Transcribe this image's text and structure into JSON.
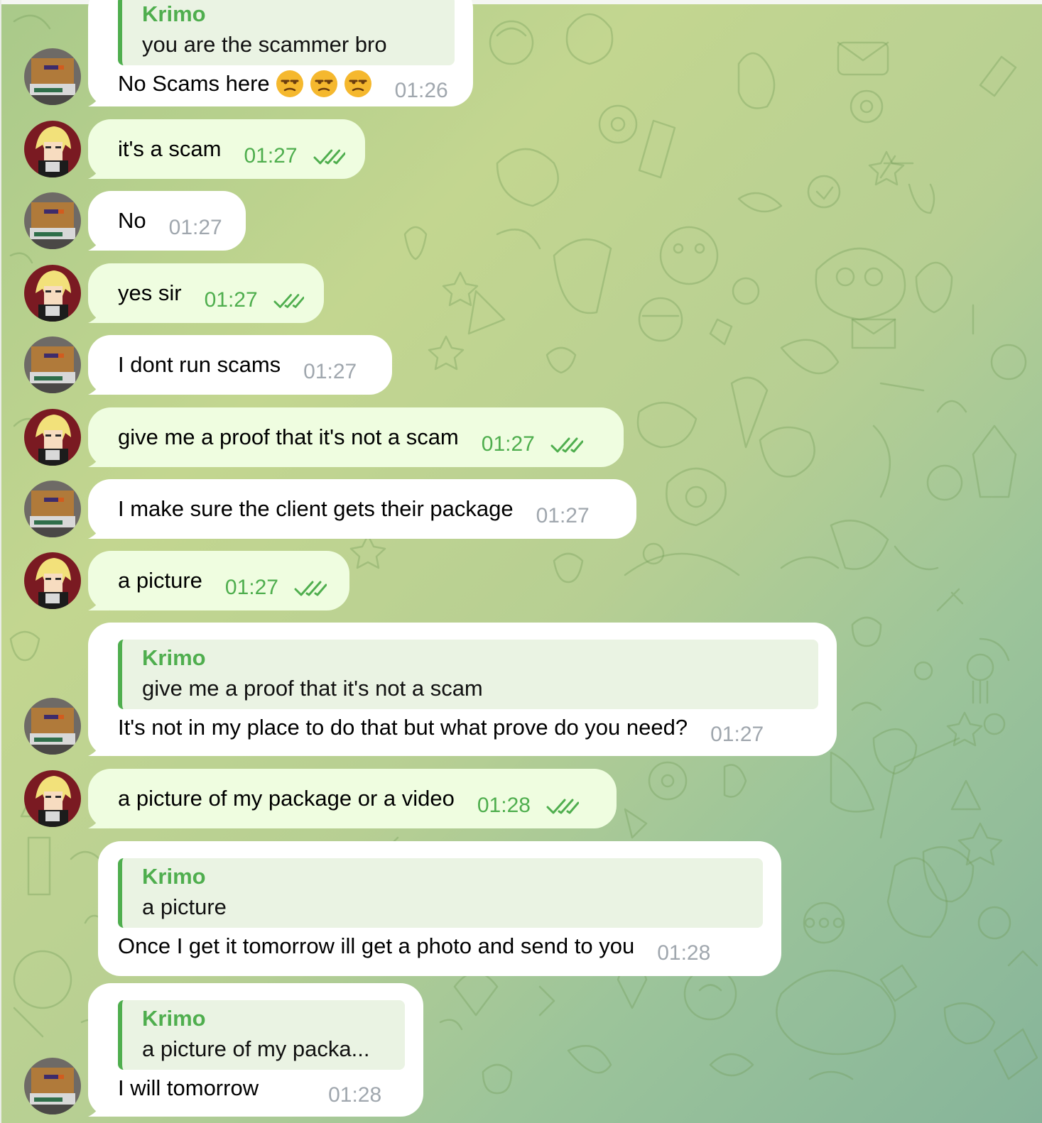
{
  "colors": {
    "accent": "#4fae4e",
    "incoming_bubble": "#ffffff",
    "outgoing_bubble": "#effde0",
    "time_incoming": "#a0a7ae"
  },
  "messages": [
    {
      "side": "in",
      "avatar": "fedex-box-avatar",
      "quote": {
        "name": "Krimo",
        "text": "you are the scammer bro"
      },
      "text": "No Scams here",
      "emoji": [
        "unamused-face",
        "unamused-face",
        "unamused-face"
      ],
      "time": "01:26"
    },
    {
      "side": "out",
      "avatar": "anime-avatar",
      "text": "it's a scam",
      "time": "01:27",
      "read": true
    },
    {
      "side": "in",
      "avatar": "fedex-box-avatar",
      "text": "No",
      "time": "01:27"
    },
    {
      "side": "out",
      "avatar": "anime-avatar",
      "text": "yes sir",
      "time": "01:27",
      "read": true
    },
    {
      "side": "in",
      "avatar": "fedex-box-avatar",
      "text": "I dont run scams",
      "time": "01:27"
    },
    {
      "side": "out",
      "avatar": "anime-avatar",
      "text": "give me a proof that it's not a scam",
      "time": "01:27",
      "read": true
    },
    {
      "side": "in",
      "avatar": "fedex-box-avatar",
      "text": "I make sure the client gets their package",
      "time": "01:27"
    },
    {
      "side": "out",
      "avatar": "anime-avatar",
      "text": "a picture",
      "time": "01:27",
      "read": true
    },
    {
      "side": "in",
      "avatar": "fedex-box-avatar",
      "quote": {
        "name": "Krimo",
        "text": "give me a proof that it's not a scam"
      },
      "text": "It's not in my place to do that but what prove do you need?",
      "time": "01:27"
    },
    {
      "side": "out",
      "avatar": "anime-avatar",
      "text": "a picture of my package or a video",
      "time": "01:28",
      "read": true
    },
    {
      "side": "in",
      "quote": {
        "name": "Krimo",
        "text": "a picture"
      },
      "text": "Once I get it tomorrow ill get a photo and send to you",
      "time": "01:28"
    },
    {
      "side": "in",
      "avatar": "fedex-box-avatar",
      "quote": {
        "name": "Krimo",
        "text": "a picture of my packa..."
      },
      "text": "I will tomorrow",
      "time": "01:28"
    }
  ]
}
